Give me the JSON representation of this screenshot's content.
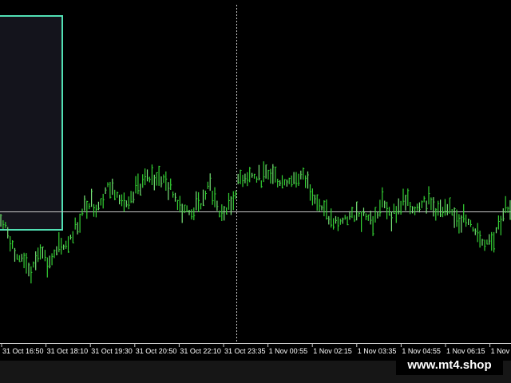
{
  "colors": {
    "background": "#000000",
    "bar_up": "#33d033",
    "bar_alt": "#7be37b",
    "grid_line": "#c8c8c8",
    "box_border": "#52e0b4",
    "box_fill": "#14141c",
    "axis_text": "#ffffff",
    "footer": "#161616"
  },
  "watermark": "www.mt4.shop",
  "chart_data": {
    "type": "bar",
    "x_ticks": [
      "31 Oct 16:50",
      "31 Oct 18:10",
      "31 Oct 19:30",
      "31 Oct 20:50",
      "31 Oct 22:10",
      "31 Oct 23:35",
      "1 Nov 00:55",
      "1 Nov 02:15",
      "1 Nov 03:35",
      "1 Nov 04:55",
      "1 Nov 06:15",
      "1 Nov 0"
    ],
    "price_profile": [
      [
        0.0,
        0.49
      ],
      [
        0.015,
        0.43
      ],
      [
        0.03,
        0.26
      ],
      [
        0.045,
        0.28
      ],
      [
        0.06,
        0.18
      ],
      [
        0.08,
        0.36
      ],
      [
        0.09,
        0.23
      ],
      [
        0.11,
        0.3
      ],
      [
        0.13,
        0.36
      ],
      [
        0.15,
        0.47
      ],
      [
        0.17,
        0.6
      ],
      [
        0.19,
        0.58
      ],
      [
        0.21,
        0.7
      ],
      [
        0.23,
        0.66
      ],
      [
        0.25,
        0.56
      ],
      [
        0.27,
        0.7
      ],
      [
        0.29,
        0.74
      ],
      [
        0.31,
        0.76
      ],
      [
        0.33,
        0.7
      ],
      [
        0.35,
        0.6
      ],
      [
        0.37,
        0.54
      ],
      [
        0.39,
        0.57
      ],
      [
        0.41,
        0.71
      ],
      [
        0.43,
        0.53
      ],
      [
        0.45,
        0.57
      ],
      [
        0.47,
        0.75
      ],
      [
        0.49,
        0.77
      ],
      [
        0.51,
        0.73
      ],
      [
        0.53,
        0.77
      ],
      [
        0.55,
        0.72
      ],
      [
        0.57,
        0.74
      ],
      [
        0.59,
        0.76
      ],
      [
        0.61,
        0.69
      ],
      [
        0.63,
        0.56
      ],
      [
        0.65,
        0.48
      ],
      [
        0.67,
        0.49
      ],
      [
        0.69,
        0.52
      ],
      [
        0.71,
        0.55
      ],
      [
        0.73,
        0.48
      ],
      [
        0.75,
        0.59
      ],
      [
        0.77,
        0.54
      ],
      [
        0.79,
        0.6
      ],
      [
        0.81,
        0.56
      ],
      [
        0.83,
        0.62
      ],
      [
        0.85,
        0.57
      ],
      [
        0.87,
        0.53
      ],
      [
        0.89,
        0.54
      ],
      [
        0.91,
        0.5
      ],
      [
        0.93,
        0.44
      ],
      [
        0.95,
        0.36
      ],
      [
        0.97,
        0.42
      ],
      [
        0.99,
        0.56
      ],
      [
        1.0,
        0.54
      ]
    ],
    "bar_count": 220,
    "grid": false
  }
}
